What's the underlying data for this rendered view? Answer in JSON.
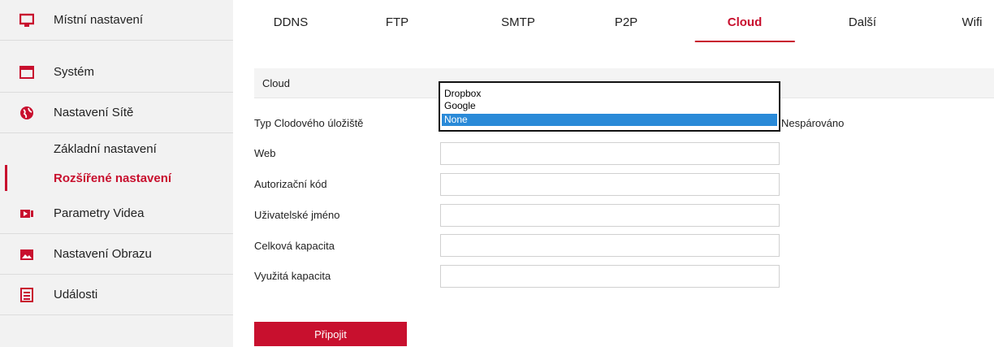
{
  "sidebar": {
    "items": [
      {
        "label": "Místní nastavení",
        "icon": "monitor-icon"
      },
      {
        "label": "Systém",
        "icon": "system-window-icon"
      },
      {
        "label": "Nastavení Sítě",
        "icon": "globe-icon"
      },
      {
        "label": "Parametry Videa",
        "icon": "video-icon"
      },
      {
        "label": "Nastavení Obrazu",
        "icon": "image-icon"
      },
      {
        "label": "Události",
        "icon": "events-icon"
      }
    ],
    "sub_items": [
      {
        "label": "Základní nastavení"
      },
      {
        "label": "Rozšířené nastavení",
        "active": true
      }
    ]
  },
  "tabs": [
    {
      "label": "DDNS"
    },
    {
      "label": "FTP"
    },
    {
      "label": "SMTP"
    },
    {
      "label": "P2P"
    },
    {
      "label": "Cloud",
      "active": true
    },
    {
      "label": "Další"
    },
    {
      "label": "Wifi"
    }
  ],
  "section": {
    "title": "Cloud"
  },
  "form": {
    "storage_type_label": "Typ Clodového úložiště",
    "web_label": "Web",
    "auth_code_label": "Autorizační kód",
    "username_label": "Uživatelské jméno",
    "total_capacity_label": "Celková kapacita",
    "used_capacity_label": "Využitá kapacita",
    "status": "Nespárováno",
    "web_value": "",
    "auth_code_value": "",
    "username_value": "",
    "total_capacity_value": "",
    "used_capacity_value": ""
  },
  "dropdown": {
    "options": [
      "Dropbox",
      "Google",
      "None"
    ],
    "selected": "None"
  },
  "connect_button": "Připojit",
  "colors": {
    "accent": "#c8102e",
    "selection": "#2a8ad8",
    "sidebar_bg": "#f2f2f2"
  }
}
